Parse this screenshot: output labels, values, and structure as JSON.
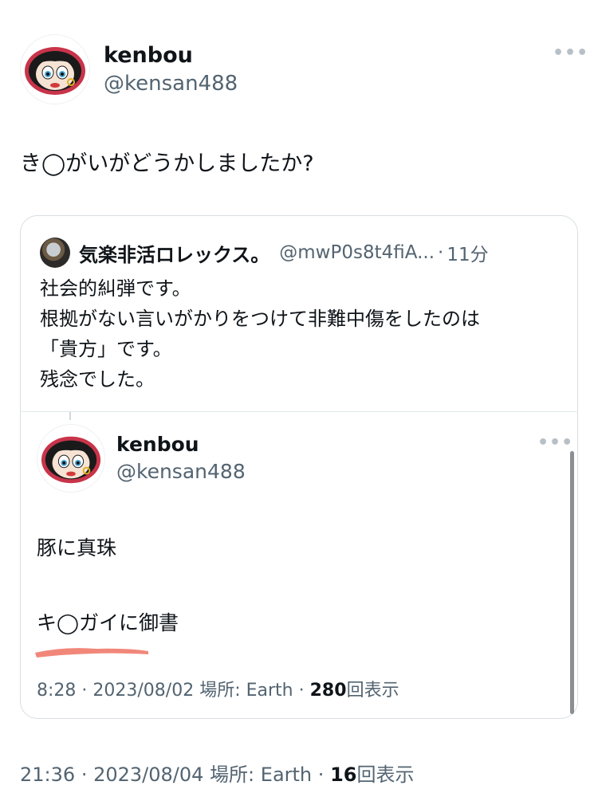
{
  "tweet": {
    "author_name": "kenbou",
    "author_handle": "@kensan488",
    "text": "き◯がいがどうかしましたか?",
    "time": "21:36",
    "date": "2023/08/04",
    "location_label": "場所: Earth",
    "views_count": "16",
    "views_label": "回表示",
    "more_icon": "more-dots-icon"
  },
  "quote": {
    "author_name": "気楽非活ロレックス。",
    "author_handle": "@mwP0s8t4fiA...",
    "separator": "·",
    "time_ago": "11分",
    "lines": [
      "社会的糾弾です。",
      "根拠がない言いがかりをつけて非難中傷をしたのは",
      "「貴方」です。",
      "残念でした。"
    ]
  },
  "inner": {
    "author_name": "kenbou",
    "author_handle": "@kensan488",
    "line1": "豚に真珠",
    "line2": "キ◯ガイに御書",
    "time": "8:28",
    "date": "2023/08/02",
    "location_label": "場所: Earth",
    "views_count": "280",
    "views_label": "回表示"
  },
  "meta_separator": "·",
  "colors": {
    "accent_underline": "#f07a6c",
    "muted_text": "#536471",
    "card_border": "#d9dee2"
  }
}
